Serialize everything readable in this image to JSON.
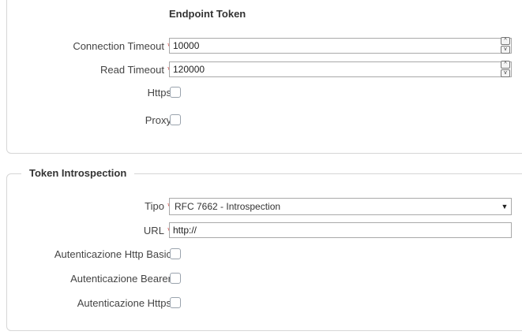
{
  "endpoint": {
    "title": "Endpoint Token",
    "connection_timeout": {
      "label": "Connection Timeout",
      "required": "*",
      "value": "10000"
    },
    "read_timeout": {
      "label": "Read Timeout",
      "required": "*",
      "value": "120000"
    },
    "https": {
      "label": "Https",
      "checked": false
    },
    "proxy": {
      "label": "Proxy",
      "checked": false
    },
    "spin_up": "^",
    "spin_down": "v"
  },
  "introspection": {
    "legend": "Token Introspection",
    "tipo": {
      "label": "Tipo",
      "required": "*",
      "selected": "RFC 7662 - Introspection",
      "arrow": "▼"
    },
    "url": {
      "label": "URL",
      "required": "*",
      "value": "http://"
    },
    "basic": {
      "label": "Autenticazione Http Basic",
      "checked": false
    },
    "bearer": {
      "label": "Autenticazione Bearer",
      "checked": false
    },
    "https": {
      "label": "Autenticazione Https",
      "checked": false
    }
  }
}
